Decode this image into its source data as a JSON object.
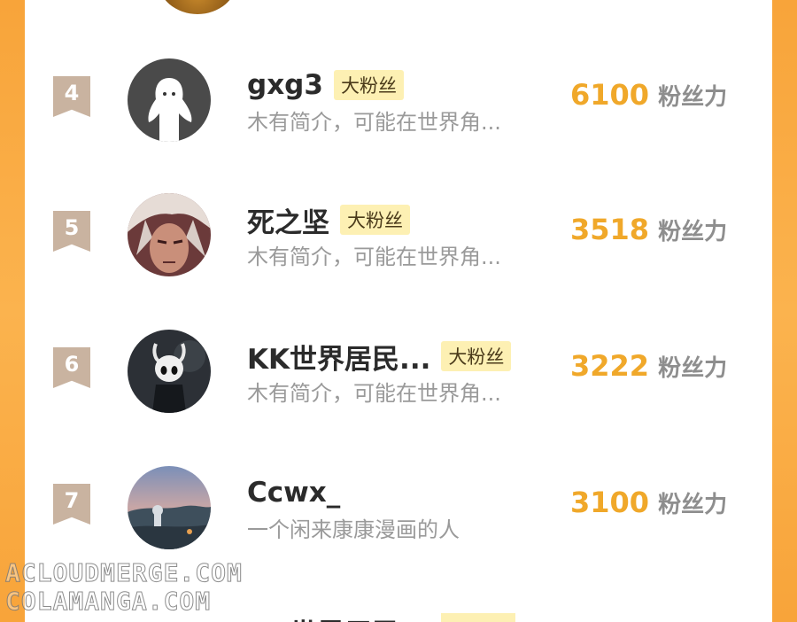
{
  "rows": [
    {
      "rank": "4",
      "name": "gxg3",
      "badge": "大粉丝",
      "bio": "木有简介，可能在世界角...",
      "score": "6100",
      "unit": "粉丝力",
      "avatar": "ghost-avatar"
    },
    {
      "rank": "5",
      "name": "死之坚",
      "badge": "大粉丝",
      "bio": "木有简介，可能在世界角...",
      "score": "3518",
      "unit": "粉丝力",
      "avatar": "anime-white-hair-avatar"
    },
    {
      "rank": "6",
      "name": "KK世界居民...",
      "badge": "大粉丝",
      "bio": "木有简介，可能在世界角...",
      "score": "3222",
      "unit": "粉丝力",
      "avatar": "hollow-knight-avatar"
    },
    {
      "rank": "7",
      "name": "Ccwx_",
      "badge": "",
      "bio": "一个闲来康康漫画的人",
      "score": "3100",
      "unit": "粉丝力",
      "avatar": "landscape-avatar"
    }
  ],
  "partial_row": {
    "name": "KK世界居民..."
  },
  "watermarks": [
    "ACLOUDMERGE.COM",
    "COLAMANGA.COM"
  ],
  "colors": {
    "score": "#f0a82a",
    "rank_bg": "#c9b3a0",
    "badge_bg": "#fdf0b3",
    "background": "#f8a43a"
  }
}
